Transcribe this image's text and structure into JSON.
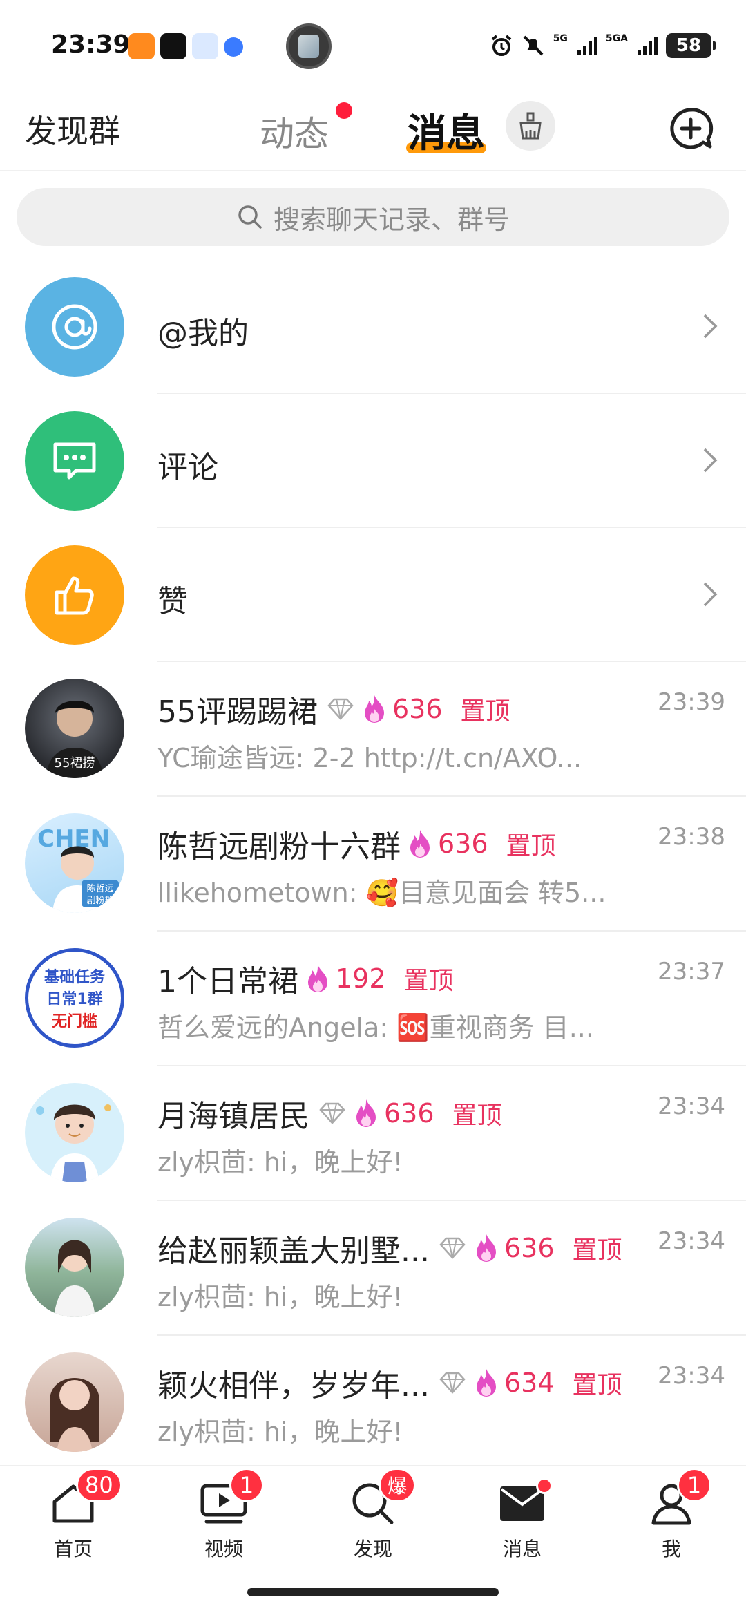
{
  "status_bar": {
    "time": "23:39",
    "apps": [
      "weibo-icon",
      "tiktok-icon",
      "qq-icon",
      "browser-icon"
    ],
    "network_1": "5G",
    "network_2": "5GA",
    "battery": "58"
  },
  "header": {
    "left_label": "发现群",
    "tab_dongtai": "动态",
    "tab_xiaoxi": "消息",
    "accent_color": "#ff9a0b"
  },
  "search": {
    "placeholder": "搜索聊天记录、群号"
  },
  "categories": [
    {
      "label": "@我的",
      "icon": "at-icon",
      "color": "#5ab3e3"
    },
    {
      "label": "评论",
      "icon": "comment-icon",
      "color": "#2fbf7a"
    },
    {
      "label": "赞",
      "icon": "thumbs-up-icon",
      "color": "#ffa514"
    }
  ],
  "chats": [
    {
      "name": "55评踢踢裙",
      "diamond": true,
      "hot": "636",
      "pin": "置顶",
      "time": "23:39",
      "preview": "YC瑜途皆远: 2-2 http://t.cn/AXO...",
      "avatar_text": "55裙捞"
    },
    {
      "name": "陈哲远剧粉十六群",
      "diamond": false,
      "hot": "636",
      "pin": "置顶",
      "time": "23:38",
      "preview": "llikehometown: 🥰目意见面会 转5...",
      "avatar_text": "陈哲远 剧粉群"
    },
    {
      "name": "1个日常裙",
      "diamond": false,
      "hot": "192",
      "pin": "置顶",
      "time": "23:37",
      "preview": "哲么爱远的Angela: 🆘重视商务 目...",
      "avatar_text": "基础任务 日常1群 无门槛"
    },
    {
      "name": "月海镇居民",
      "diamond": true,
      "hot": "636",
      "pin": "置顶",
      "time": "23:34",
      "preview": "zly枳茴: hi，晚上好!",
      "avatar_text": ""
    },
    {
      "name": "给赵丽颖盖大别墅...",
      "diamond": true,
      "hot": "636",
      "pin": "置顶",
      "time": "23:34",
      "preview": "zly枳茴: hi，晚上好!",
      "avatar_text": ""
    },
    {
      "name": "颖火相伴，岁岁年...",
      "diamond": true,
      "hot": "634",
      "pin": "置顶",
      "time": "23:34",
      "preview": "zly枳茴: hi，晚上好!",
      "avatar_text": ""
    }
  ],
  "bottom_nav": [
    {
      "label": "首页",
      "icon": "home-icon",
      "badge": "80"
    },
    {
      "label": "视频",
      "icon": "video-icon",
      "badge": "1"
    },
    {
      "label": "发现",
      "icon": "discover-icon",
      "badge": "爆"
    },
    {
      "label": "消息",
      "icon": "message-icon",
      "badge": ""
    },
    {
      "label": "我",
      "icon": "profile-icon",
      "badge": "1"
    }
  ]
}
